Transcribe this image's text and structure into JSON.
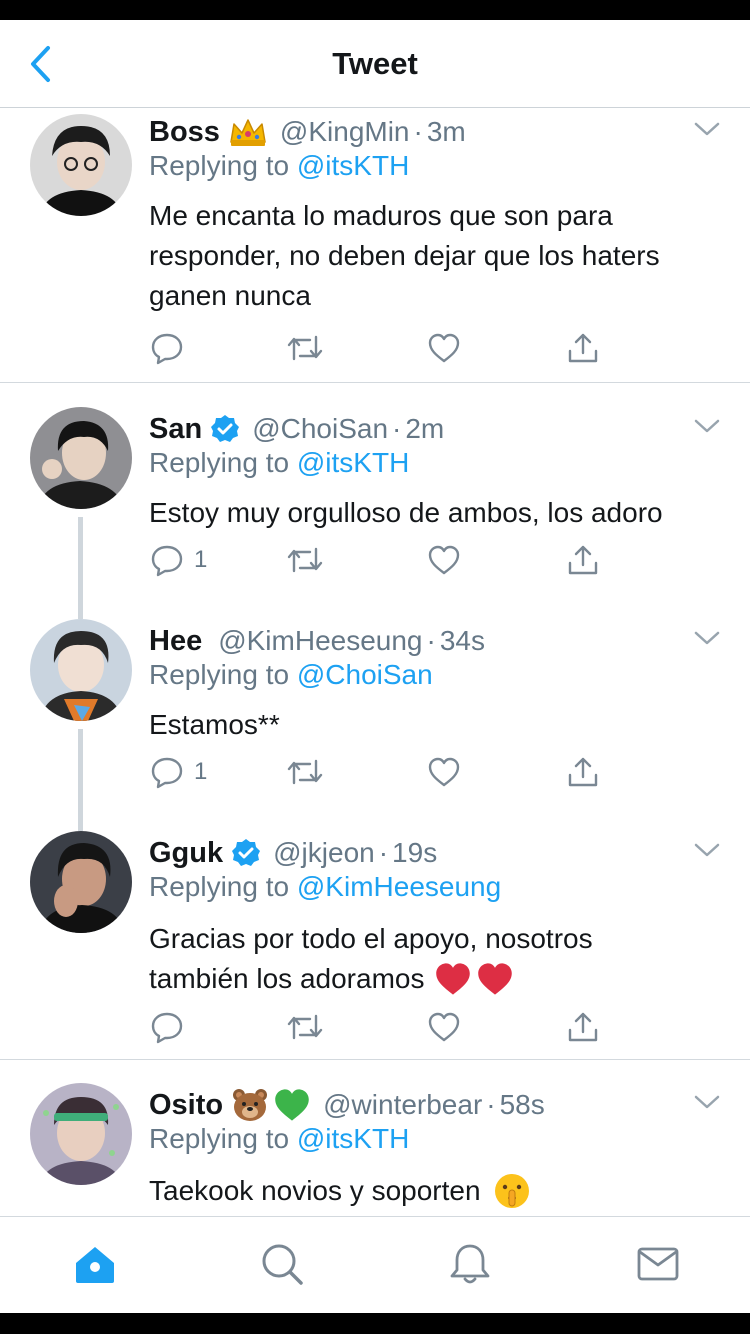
{
  "header": {
    "title": "Tweet"
  },
  "tweets": [
    {
      "name": "Boss",
      "badge_emoji": "👑",
      "handle": "@KingMin",
      "time": "3m",
      "replying_prefix": "Replying to ",
      "replying_to": "@itsKTH",
      "text_lines": [
        "Me encanta lo maduros que son para",
        "responder, no deben dejar que los haters",
        "ganen nunca"
      ],
      "reply_count": ""
    },
    {
      "name": "San",
      "verified": true,
      "handle": "@ChoiSan",
      "time": "2m",
      "replying_prefix": "Replying to ",
      "replying_to": "@itsKTH",
      "text_lines": [
        "Estoy muy orgulloso de ambos, los adoro"
      ],
      "reply_count": "1"
    },
    {
      "name": "Hee",
      "handle": "@KimHeeseung",
      "time": "34s",
      "replying_prefix": "Replying to ",
      "replying_to": "@ChoiSan",
      "text_lines": [
        "Estamos**"
      ],
      "reply_count": "1"
    },
    {
      "name": "Gguk",
      "verified": true,
      "handle": "@jkjeon",
      "time": "19s",
      "replying_prefix": "Replying to ",
      "replying_to": "@KimHeeseung",
      "text_lines": [
        "Gracias por todo el apoyo, nosotros",
        "también los adoramos"
      ],
      "trailing_emoji": "❤️❤️",
      "reply_count": ""
    },
    {
      "name": "Osito",
      "badge_emoji": "🐻💚",
      "handle": "@winterbear",
      "time": "58s",
      "replying_prefix": "Replying to ",
      "replying_to": "@itsKTH",
      "text_lines": [
        "Taekook novios y soporten"
      ],
      "trailing_emoji": "🤫",
      "reply_count": ""
    }
  ],
  "separator": "·",
  "icons": {
    "back": "chevron-left-icon",
    "chevron": "chevron-down-icon",
    "reply": "reply-icon",
    "retweet": "retweet-icon",
    "like": "heart-icon",
    "share": "share-icon",
    "home": "home-icon",
    "search": "search-icon",
    "notifications": "bell-icon",
    "messages": "mail-icon"
  },
  "colors": {
    "accent": "#1da1f2",
    "text": "#14171a",
    "muted": "#657786",
    "divider": "#d3d9de",
    "icon_gray": "#7a8793"
  }
}
